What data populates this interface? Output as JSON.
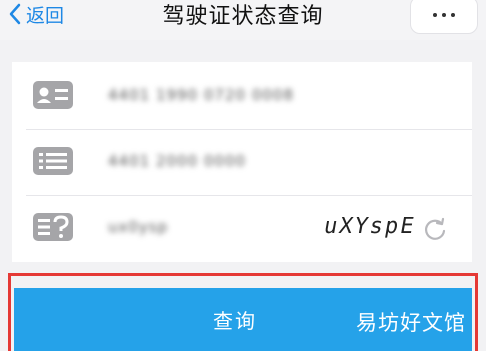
{
  "header": {
    "back_label": "返回",
    "title": "驾驶证状态查询"
  },
  "form": {
    "rows": [
      {
        "icon": "id-card-icon",
        "value": "4401 1990 0720 0008"
      },
      {
        "icon": "list-card-icon",
        "value": "4401 2000 0000"
      },
      {
        "icon": "captcha-question-icon",
        "value": "ux0ysp"
      }
    ],
    "captcha_text": "uXYspE"
  },
  "actions": {
    "query_label": "查询"
  },
  "watermark": "易坊好文馆",
  "colors": {
    "accent": "#1e88e5",
    "button": "#25a2e9",
    "highlight": "#e53935"
  }
}
